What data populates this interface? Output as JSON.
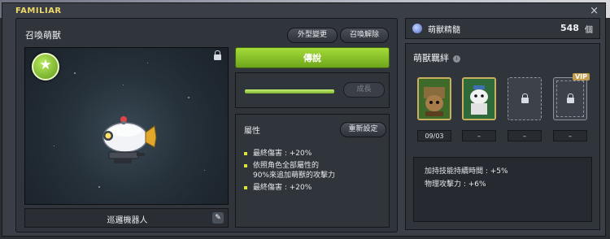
{
  "window": {
    "title": "FAMILIAR",
    "close_icon": "×"
  },
  "summon": {
    "header": "召喚萌獸",
    "appearance_button": "外型變更",
    "release_button": "召喚解除",
    "familiar_name": "巡邏機器人",
    "rank_badge_icon": "★"
  },
  "rank": {
    "label": "傳說",
    "color": "#8bc62b"
  },
  "growth": {
    "button": "成長",
    "progress": 1.0
  },
  "attributes": {
    "title": "屬性",
    "reset_button": "重新設定",
    "items": [
      "最終傷害 : +20%",
      "依照角色全部屬性的",
      "90%來追加萌獸的攻擊力",
      "最終傷害 : +20%"
    ]
  },
  "essence": {
    "label": "萌獸精髓",
    "value": "548",
    "unit": "個"
  },
  "bond": {
    "title": "萌獸羈絆",
    "info_icon": "i",
    "vip_label": "VIP",
    "slots": [
      "09/03",
      "–",
      "–",
      "–"
    ],
    "effects": [
      "加持技能持續時間 : +5%",
      "物理攻擊力 : +6%"
    ]
  }
}
